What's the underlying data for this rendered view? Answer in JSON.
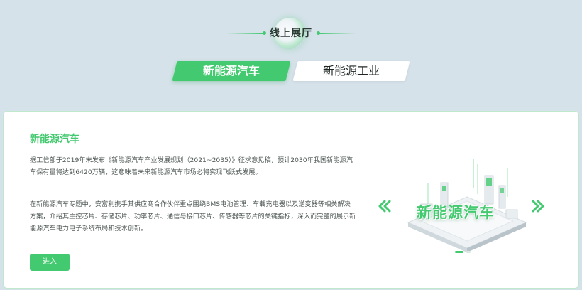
{
  "header": {
    "title": "线上展厅"
  },
  "tabs": [
    {
      "label": "新能源汽车",
      "active": true
    },
    {
      "label": "新能源工业",
      "active": false
    }
  ],
  "content": {
    "section_title": "新能源汽车",
    "paragraphs": [
      "据工信部于2019年末发布《新能源汽车产业发展规划（2021~2035）》征求意见稿，预计2030年我国新能源汽车保有量将达到6420万辆，这意味着未来新能源汽车市场必将实现飞跃式发展。",
      "在新能源汽车专题中，安富利携手其供应商合作伙伴重点围绕BMS电池管理、车载充电器以及逆变器等相关解决方案，介绍其主控芯片、存储芯片、功率芯片、通信与接口芯片、传感器等芯片的关键指标，深入而完整的展示新能源汽车电力电子系统布局和技术创新。"
    ],
    "enter_label": "进入"
  },
  "carousel": {
    "slide_label": "新能源汽车",
    "prev_icon": "chevron-double-left-icon",
    "next_icon": "chevron-double-right-icon",
    "slide_count": 2,
    "active_index": 0
  },
  "colors": {
    "accent": "#43c96f",
    "background": "#d6e2ea",
    "card": "#ffffff",
    "text": "#4c5652"
  }
}
